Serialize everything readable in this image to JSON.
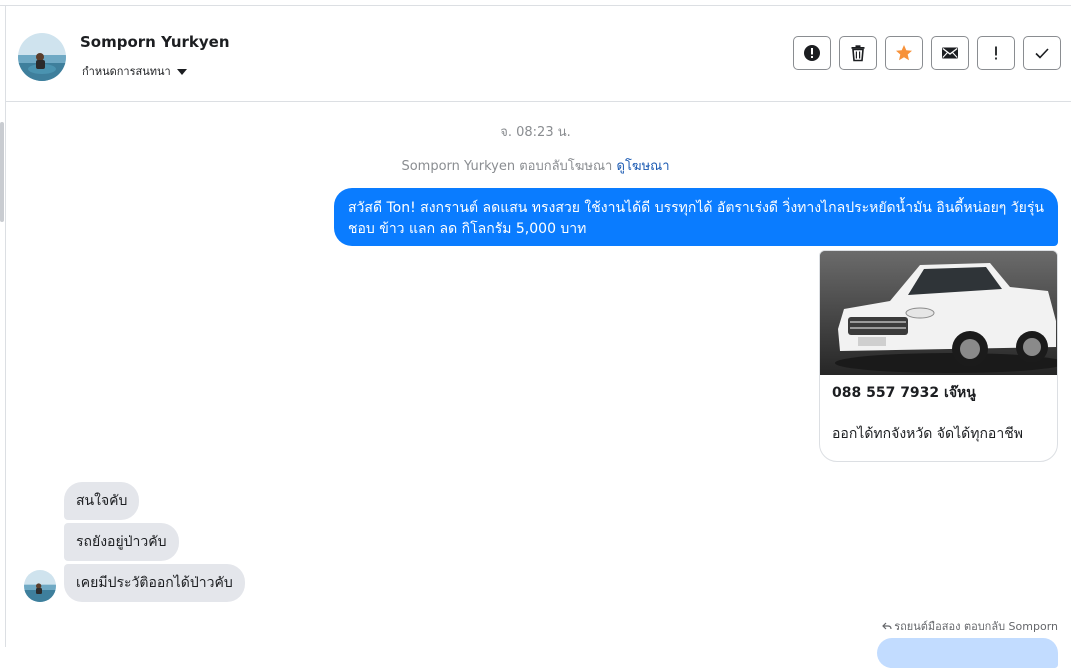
{
  "header": {
    "contact_name": "Somporn Yurkyen",
    "conversation_settings": "กำหนดการสนทนา",
    "actions": [
      {
        "name": "report-icon"
      },
      {
        "name": "trash-icon"
      },
      {
        "name": "star-icon",
        "color": "#f7923a"
      },
      {
        "name": "envelope-icon"
      },
      {
        "name": "exclamation-icon"
      },
      {
        "name": "check-icon"
      }
    ]
  },
  "messages": {
    "timestamp": "จ. 08:23 น.",
    "ad_reply_prefix": "Somporn Yurkyen ตอบกลับโฆษณา",
    "ad_reply_link": "ดูโฆษณา",
    "outgoing_text": "สวัสดี Ton! สงกรานต์ ลดแสน ทรงสวย ใช้งานได้ดี บรรทุกได้ อัตราเร่งดี วิ่งทางไกลประหยัดน้ำมัน อินดี้หน่อยๆ วัยรุ่นชอบ ข้าว แลก ลด กิโลกรัม 5,000 บาท",
    "ad_card": {
      "title": "088 557 7932 เจ๊หนู",
      "description": "ออกได้ทกจังหวัด จัดได้ทุกอาชีพ"
    },
    "incoming": [
      "สนใจคับ",
      "รถยังอยู่ป่าวคับ",
      "เคยมีประวัติออกได้ป่าวคับ"
    ],
    "reply_note": "รถยนต์มือสอง ตอบกลับ Somporn"
  },
  "colors": {
    "outgoing_bubble": "#0a7cff",
    "incoming_bubble": "#e4e6eb",
    "link": "#1c5bb3"
  }
}
